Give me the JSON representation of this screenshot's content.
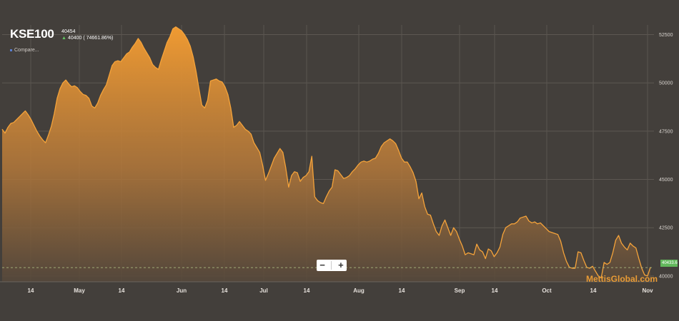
{
  "header": {
    "symbol": "KSE100",
    "open_value": "40454",
    "change_text": "40400 ( 74661.86%)",
    "compare_label": "Compare..."
  },
  "zoom": {
    "minus": "−",
    "plus": "+"
  },
  "last_price_label": "40433.64",
  "watermark": "MettisGlobal.com",
  "colors": {
    "line": "#f0a030",
    "fill_top": "#e8922c",
    "fill_bottom": "#5a4a3a",
    "badge": "#62b85c",
    "background": "#433f3b"
  },
  "chart_data": {
    "type": "area",
    "title": "",
    "xlabel": "",
    "ylabel": "",
    "y_ticks": [
      "40000",
      "42500",
      "45000",
      "47500",
      "50000",
      "52500"
    ],
    "ylim": [
      39700,
      53000
    ],
    "x_ticks": [
      "14",
      "May",
      "14",
      "Jun",
      "14",
      "Jul",
      "14",
      "Aug",
      "14",
      "Sep",
      "14",
      "Oct",
      "14",
      "Nov"
    ],
    "grid": true,
    "current_level": 40433.64,
    "values": [
      47600,
      47400,
      47700,
      47900,
      47950,
      48100,
      48250,
      48400,
      48550,
      48350,
      48100,
      47800,
      47500,
      47250,
      47050,
      46900,
      47300,
      47750,
      48400,
      49200,
      49700,
      50000,
      50150,
      49950,
      49800,
      49850,
      49750,
      49550,
      49400,
      49350,
      49200,
      48800,
      48700,
      48950,
      49350,
      49650,
      49900,
      50400,
      50900,
      51100,
      51150,
      51100,
      51300,
      51500,
      51600,
      51850,
      52050,
      52300,
      52100,
      51800,
      51550,
      51300,
      50950,
      50800,
      50700,
      51200,
      51650,
      52100,
      52400,
      52800,
      52900,
      52800,
      52700,
      52500,
      52250,
      51900,
      51350,
      50600,
      49700,
      48850,
      48700,
      49100,
      50100,
      50150,
      50200,
      50100,
      50050,
      49800,
      49400,
      48700,
      47700,
      47800,
      48000,
      47800,
      47600,
      47500,
      47350,
      46900,
      46650,
      46400,
      45750,
      44950,
      45300,
      45700,
      46100,
      46350,
      46600,
      46400,
      45600,
      44600,
      45200,
      45400,
      45350,
      44900,
      45100,
      45200,
      45400,
      46200,
      44100,
      43900,
      43800,
      43750,
      44100,
      44400,
      44600,
      45500,
      45450,
      45250,
      45050,
      45100,
      45200,
      45400,
      45550,
      45750,
      45900,
      45950,
      45900,
      45950,
      46050,
      46100,
      46350,
      46700,
      46900,
      47000,
      47100,
      47000,
      46850,
      46500,
      46100,
      45900,
      45900,
      45650,
      45350,
      44900,
      44000,
      44300,
      43600,
      43200,
      43150,
      42700,
      42300,
      42100,
      42600,
      42900,
      42500,
      42100,
      42500,
      42300,
      41900,
      41550,
      41100,
      41200,
      41150,
      41100,
      41650,
      41350,
      41250,
      40900,
      41400,
      41300,
      41000,
      41200,
      41500,
      42150,
      42500,
      42600,
      42700,
      42700,
      42800,
      43000,
      43050,
      43100,
      42850,
      42750,
      42800,
      42700,
      42750,
      42600,
      42450,
      42300,
      42250,
      42200,
      42150,
      41800,
      41200,
      40750,
      40450,
      40400,
      40400,
      41250,
      41200,
      40800,
      40450,
      40400,
      40500,
      40250,
      40000,
      39900,
      40700,
      40600,
      40700,
      41200,
      41850,
      42100,
      41700,
      41500,
      41350,
      41700,
      41550,
      41450,
      40900,
      40400,
      40050,
      40000,
      40450
    ]
  }
}
